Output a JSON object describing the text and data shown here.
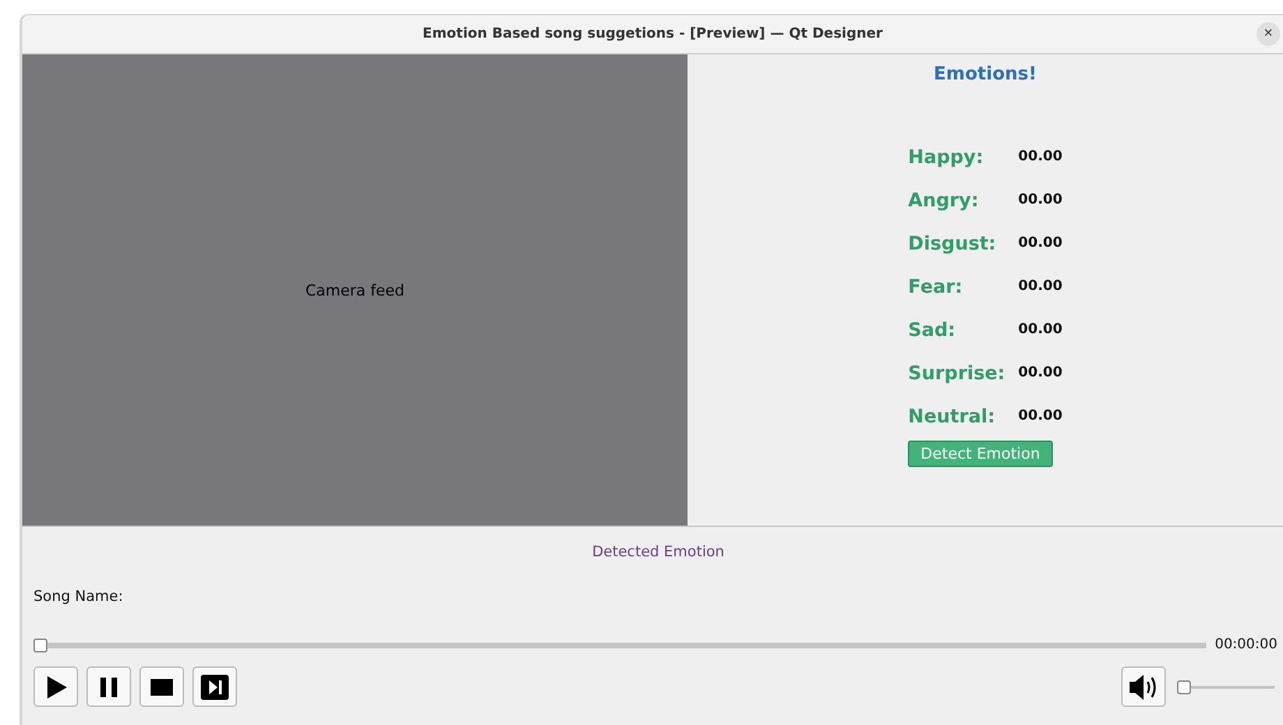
{
  "window": {
    "title": "Emotion Based song suggetions - [Preview] — Qt Designer",
    "close": "×"
  },
  "camera": {
    "label": "Camera feed"
  },
  "emotions": {
    "heading": "Emotions!",
    "rows": [
      {
        "label": "Happy:",
        "value": "00.00"
      },
      {
        "label": "Angry:",
        "value": "00.00"
      },
      {
        "label": "Disgust:",
        "value": "00.00"
      },
      {
        "label": "Fear:",
        "value": "00.00"
      },
      {
        "label": "Sad:",
        "value": "00.00"
      },
      {
        "label": "Surprise:",
        "value": "00.00"
      },
      {
        "label": "Neutral:",
        "value": "00.00"
      }
    ],
    "button": "Detect Emotion"
  },
  "detected": "Detected Emotion",
  "song_name": "Song Name:",
  "seek": {
    "level": 0,
    "time": "00:00:00"
  },
  "controls": [
    {
      "kind": "play"
    },
    {
      "kind": "pause"
    },
    {
      "kind": "stop"
    },
    {
      "kind": "next"
    }
  ],
  "volume": {
    "level": 0
  }
}
